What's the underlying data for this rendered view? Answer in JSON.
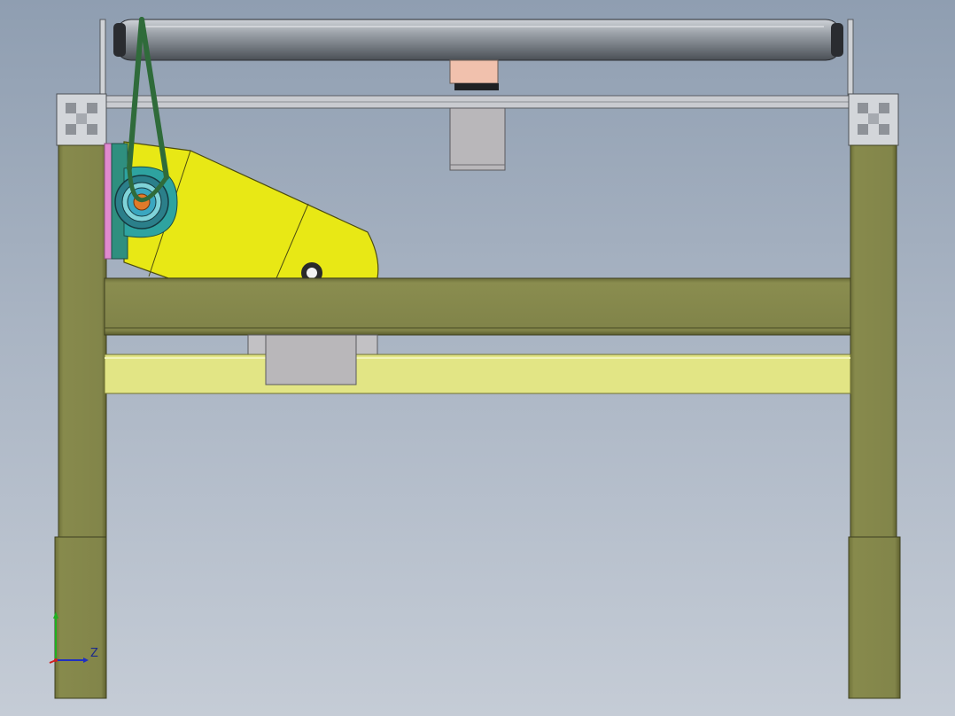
{
  "viewport": {
    "title": "",
    "background": "#a9b4c3"
  },
  "triad": {
    "z_label": "Z",
    "colors": {
      "x": "#d02020",
      "y": "#20b020",
      "z": "#2030c0"
    }
  },
  "colors": {
    "frame_olive": "#82854a",
    "frame_dark": "#5e6031",
    "yellow_housing": "#e8e815",
    "pale_yellow_plate": "#e2e585",
    "green_belt": "#2f6b3a",
    "teal_bearing": "#2ea3a0",
    "orange_shaft": "#e07a2a",
    "pink_pad": "#e08ad0",
    "roller_grey": "#8e949b",
    "block_grey": "#b9b7ba",
    "salmon_block": "#f1c1ad"
  }
}
